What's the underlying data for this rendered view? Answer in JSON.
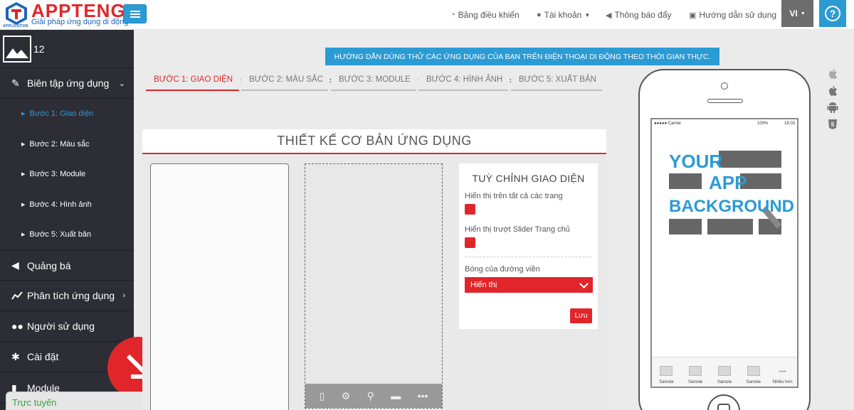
{
  "header": {
    "brand": "APPTENG",
    "badge_text": "APPLICATION",
    "tagline": "Giải pháp ứng dụng di động",
    "nav": [
      {
        "label": "Bảng điều khiển",
        "icon": "dashboard-icon"
      },
      {
        "label": "Tài khoản",
        "icon": "user-icon"
      },
      {
        "label": "Thông báo đẩy",
        "icon": "megaphone-icon"
      },
      {
        "label": "Hướng dẫn sử dụng",
        "icon": "camera-icon"
      }
    ],
    "language": "VI",
    "help": "?"
  },
  "sidebar": {
    "app_count": "12",
    "items": [
      {
        "label": "Biên tập ứng dụng",
        "icon": "pencil-icon"
      },
      {
        "label": "Quảng bá",
        "icon": "megaphone-icon"
      },
      {
        "label": "Phân tích ứng dụng",
        "icon": "chart-icon"
      },
      {
        "label": "Người sử dụng",
        "icon": "users-icon"
      },
      {
        "label": "Cài đặt",
        "icon": "gears-icon"
      },
      {
        "label": "Module",
        "icon": "module-icon"
      }
    ],
    "subitems": [
      {
        "label": "Bước 1: Giao diện",
        "active": true
      },
      {
        "label": "Bước 2: Màu sắc",
        "active": false
      },
      {
        "label": "Bước 3: Module",
        "active": false
      },
      {
        "label": "Bước 4: Hình ảnh",
        "active": false
      },
      {
        "label": "Bước 5: Xuất bản",
        "active": false
      }
    ],
    "online_label": "Trực tuyến"
  },
  "main": {
    "banner": "HƯỚNG DẪN DÙNG THỬ CÁC ỨNG DỤNG CỦA BẠN TRÊN ĐIỆN THOẠI DI ĐỘNG THEO THỜI GIAN THỰC.",
    "steps": [
      "BƯỚC 1: GIAO DIỆN",
      "BƯỚC 2: MÀU SẮC",
      "BƯỚC 3: MODULE",
      "BƯỚC 4: HÌNH ẢNH",
      "BƯỚC 5: XUẤT BẢN"
    ],
    "panel_title": "THIẾT KẾ CƠ BẢN ỨNG DỤNG",
    "customize": {
      "title": "TUỲ CHỈNH GIAO DIỆN",
      "opt1": "Hiển thị trên tất cả các trang",
      "opt2": "Hiển thị trượt Slider Trang chủ",
      "shadow_label": "Bóng của đường viền",
      "shadow_value": "Hiển thị",
      "save": "Lưu"
    }
  },
  "phone": {
    "carrier": "●●●●● Carrier",
    "battery": "100%",
    "time": "18:03",
    "bg_words": [
      "YOUR",
      "APP",
      "BACKGROUND"
    ],
    "tabs": [
      "Samole",
      "Samole",
      "Samole",
      "Samole",
      "Nhiều hơn"
    ]
  },
  "colors": {
    "accent": "#e0262b",
    "blue": "#2b9bd4",
    "sidebar": "#2d2d35"
  }
}
